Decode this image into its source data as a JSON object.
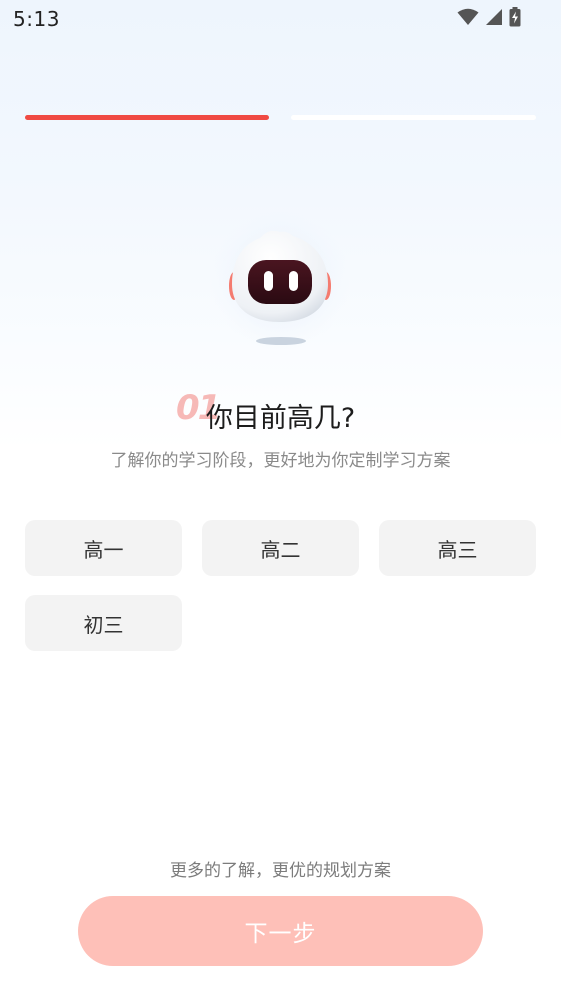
{
  "status_bar": {
    "time": "5:13",
    "icons": [
      "wifi-icon",
      "cellular-signal-icon",
      "battery-charging-icon"
    ]
  },
  "progress": {
    "total_steps": 2,
    "current_step": 1,
    "active_color": "#f04a43",
    "inactive_color": "#ffffff"
  },
  "question": {
    "index": "01",
    "title": "你目前高几?",
    "subtitle": "了解你的学习阶段，更好地为你定制学习方案"
  },
  "options": [
    {
      "label": "高一"
    },
    {
      "label": "高二"
    },
    {
      "label": "高三"
    },
    {
      "label": "初三"
    }
  ],
  "footer": {
    "hint": "更多的了解，更优的规划方案",
    "next_label": "下一步",
    "next_color": "#fec0b8"
  },
  "colors": {
    "accent": "#f04a43",
    "option_bg": "#f3f3f3"
  }
}
